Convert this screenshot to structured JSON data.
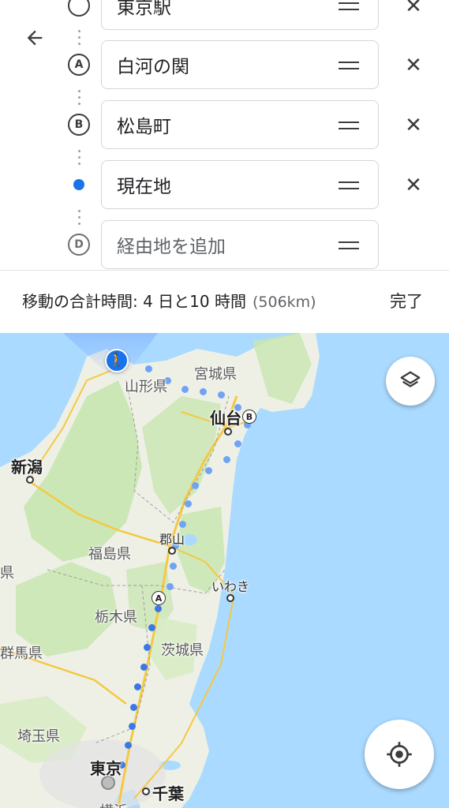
{
  "header": {
    "back_icon": "arrow-back-icon"
  },
  "stops": [
    {
      "marker": "",
      "label": "東京駅",
      "kind": "origin"
    },
    {
      "marker": "A",
      "label": "白河の関",
      "kind": "stop"
    },
    {
      "marker": "B",
      "label": "松島町",
      "kind": "stop"
    },
    {
      "marker": "",
      "label": "現在地",
      "kind": "current"
    },
    {
      "marker": "D",
      "label": "経由地を追加",
      "kind": "add"
    }
  ],
  "summary": {
    "text": "移動の合計時間: 4 日と10 時間",
    "distance": "(506km)",
    "done_label": "完了"
  },
  "map": {
    "labels": {
      "miyagi": "宮城県",
      "yamagata": "山形県",
      "sendai": "仙台",
      "niigata": "新潟",
      "koriyama": "郡山",
      "fukushima": "福島県",
      "iwaki": "いわき",
      "tochigi": "栃木県",
      "ibaraki": "茨城県",
      "gunma": "群馬県",
      "saitama": "埼玉県",
      "tokyo": "東京",
      "chiba": "千葉",
      "pref_edge": "県",
      "bottom_edge": "横浜"
    },
    "pins": {
      "a": "A",
      "b": "B"
    },
    "layers_icon": "layers-icon",
    "locate_icon": "my-location-icon",
    "walker_icon": "walking-person-icon",
    "colors": {
      "sea": "#aadaff",
      "land": "#eef0e6",
      "forest": "#c8e6b0",
      "route": "#4285f4",
      "current": "#1a73e8"
    }
  }
}
